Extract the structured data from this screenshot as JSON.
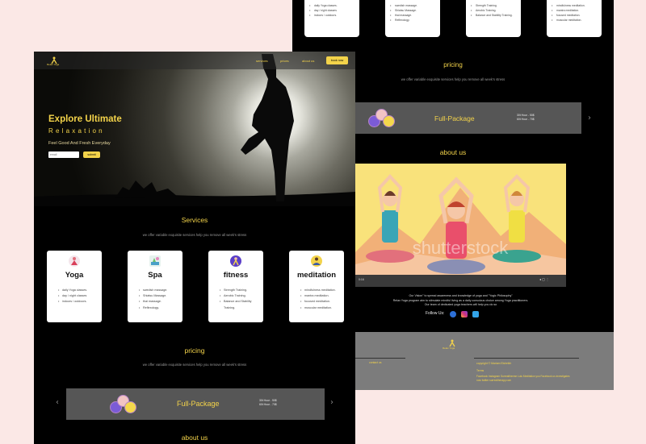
{
  "back": {
    "service_cards": [
      {
        "items": [
          "daily Yoga classes.",
          "day / night classes",
          "indoors / outdoors."
        ]
      },
      {
        "items": [
          "swedish massage.",
          "Shiatsu Massage.",
          "thai massage.",
          "Reflexology."
        ]
      },
      {
        "items": [
          "Strength Training.",
          "Aerobic Training.",
          "Balance and Stability Training."
        ]
      },
      {
        "items": [
          "mindfulness meditation.",
          "mantra meditation.",
          "focused meditation.",
          "muscular meditation."
        ]
      }
    ],
    "pricing_title": "pricing",
    "pricing_subtitle": "we offer variable exquisite services help you remove all week's stress",
    "package_title": "Full-Package",
    "package_prices": [
      "30t Hour - 50$",
      "60t Hour - 70$"
    ],
    "about_title": "about us",
    "watermark": "shutterstock",
    "about_text": [
      "Our Vision\" to spread awareness and knowledge of yoga and \"Yogic Philosophy\"",
      "Relax Yoga program aim to stimulate mindful living as a daily conscious choice among Yoga practitioners.",
      "Our team of dedicated yoga teachers will help you do so"
    ],
    "follow_label": "Follow Us:",
    "footer": {
      "logo_text": "Relax Yoga",
      "contact_label": "contact us",
      "copyright": "copyright © Mariam Elsheikh",
      "policy": "Terms",
      "note1": "Facebook Instagram Surrealtherme Lulu Meditation you Facebook us investigates",
      "note2": "now twitter surrealtherapy.com"
    },
    "video_time": "0:16"
  },
  "front": {
    "logo_text": "Relax Yoga",
    "nav": [
      "services",
      "prices",
      "about us"
    ],
    "book_label": "book now",
    "hero_title": "Explore Ultimate",
    "hero_sub": "Relaxation",
    "hero_tagline": "Feel Good And Fresh Everyday",
    "email_placeholder": "email",
    "submit_label": "submit",
    "services_title": "Services",
    "services_subtitle": "we offer variable exquisite services help you remove all week's stress",
    "services": [
      {
        "title": "Yoga",
        "icon": "yoga-pose-icon",
        "items": [
          "daily Yoga classes.",
          "day / night classes",
          "indoors / outdoors."
        ]
      },
      {
        "title": "Spa",
        "icon": "spa-icon",
        "items": [
          "swedish massage.",
          "Shiatsu Massage.",
          "thai massage.",
          "Reflexology."
        ]
      },
      {
        "title": "fitness",
        "icon": "fitness-icon",
        "items": [
          "Strength Training.",
          "Aerobic Training.",
          "Balance and Stability Training."
        ]
      },
      {
        "title": "meditation",
        "icon": "meditation-icon",
        "items": [
          "mindfulness meditation.",
          "mantra meditation.",
          "focused meditation.",
          "muscular meditation."
        ]
      }
    ],
    "pricing_title": "pricing",
    "pricing_subtitle": "we offer variable exquisite services help you remove all week's stress",
    "package_title": "Full-Package",
    "package_prices": [
      "30t Hour - 50$",
      "60t Hour - 70$"
    ],
    "about_title": "about us"
  },
  "colors": {
    "accent": "#f3d34a",
    "page_bg": "#000000",
    "banner_bg": "#565656",
    "canvas_bg": "#fbe8e6"
  }
}
